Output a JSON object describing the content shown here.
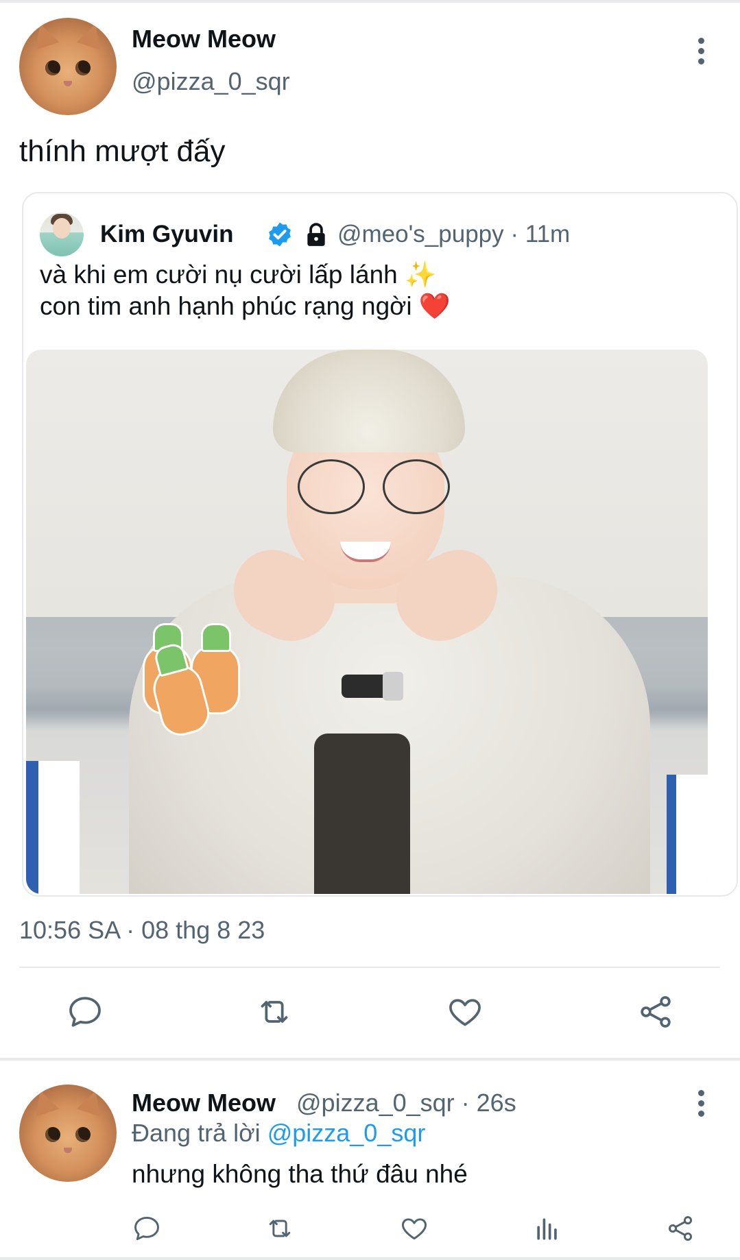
{
  "main_tweet": {
    "author_name": "Meow Meow",
    "author_handle": "@pizza_0_sqr",
    "text": "thính mượt đấy",
    "timestamp": "10:56 SA · 08 thg 8 23"
  },
  "quoted_tweet": {
    "author_name": "Kim Gyuvin",
    "verified": true,
    "protected": true,
    "handle_time": "@meo's_puppy · 11m",
    "text_line1": "và khi em cười nụ cười lấp lánh ✨",
    "text_line2": "con tim anh hạnh phúc rạng ngời ❤️"
  },
  "actions": [
    "reply-icon",
    "retweet-icon",
    "like-icon",
    "share-icon"
  ],
  "reply": {
    "author_name": "Meow Meow",
    "handle_time": "@pizza_0_sqr · 26s",
    "replying_prefix": "Đang trả lời ",
    "replying_to": "@pizza_0_sqr",
    "text": "nhưng không tha thứ đâu nhé",
    "actions": [
      "reply-icon",
      "retweet-icon",
      "like-icon",
      "analytics-icon",
      "share-icon"
    ]
  },
  "colors": {
    "accent": "#1d9bf0",
    "secondary_text": "#536471",
    "divider": "#e7e9ea"
  }
}
